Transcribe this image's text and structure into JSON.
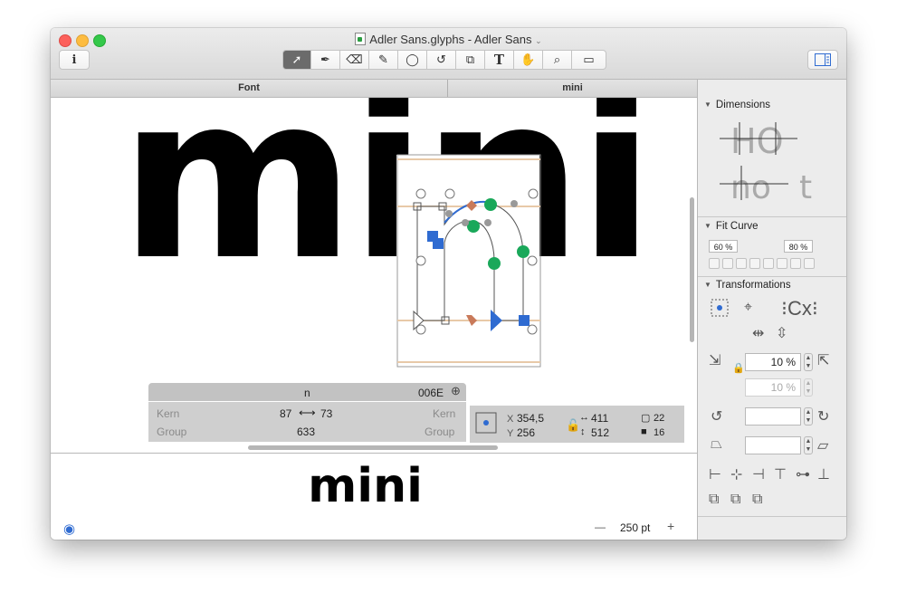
{
  "window": {
    "title": "Adler Sans.glyphs - Adler Sans"
  },
  "toolbar": {
    "info_label": "i",
    "tools": [
      {
        "name": "select-tool",
        "glyph": "➚"
      },
      {
        "name": "pen-tool",
        "glyph": "✒"
      },
      {
        "name": "eraser-tool",
        "glyph": "⌫"
      },
      {
        "name": "pencil-tool",
        "glyph": "✎"
      },
      {
        "name": "shape-tool",
        "glyph": "◯"
      },
      {
        "name": "rotate-tool",
        "glyph": "↺"
      },
      {
        "name": "scale-tool",
        "glyph": "⧉"
      },
      {
        "name": "text-tool",
        "glyph": "T"
      },
      {
        "name": "hand-tool",
        "glyph": "✋"
      },
      {
        "name": "zoom-tool",
        "glyph": "⌕"
      },
      {
        "name": "measure-tool",
        "glyph": "▭"
      }
    ]
  },
  "tabs": [
    "Font",
    "mini"
  ],
  "canvas": {
    "text": "mini"
  },
  "glyph_info": {
    "glyph_name": "n",
    "unicode": "006E",
    "kern_label": "Kern",
    "group_label": "Group",
    "left_sidebearing": "87",
    "right_sidebearing": "73",
    "width": "633"
  },
  "selection_info": {
    "x_label": "X",
    "y_label": "Y",
    "x": "354,5",
    "y": "256",
    "w": "411",
    "h": "512",
    "nodes": "22",
    "handles": "16"
  },
  "preview": {
    "text": "mini",
    "zoom": "250 pt",
    "zoom_out": "—",
    "zoom_in": "+"
  },
  "sidebar": {
    "dimensions": "Dimensions",
    "fit_curve": "Fit Curve",
    "fit_min": "60 %",
    "fit_max": "80 %",
    "transformations": "Transformations",
    "scale_value": "10 %",
    "scale_value2": "10 %"
  },
  "colors": {
    "accent": "#2f6bd1",
    "green_node": "#1aa85a",
    "orange_node": "#c97a5a"
  }
}
